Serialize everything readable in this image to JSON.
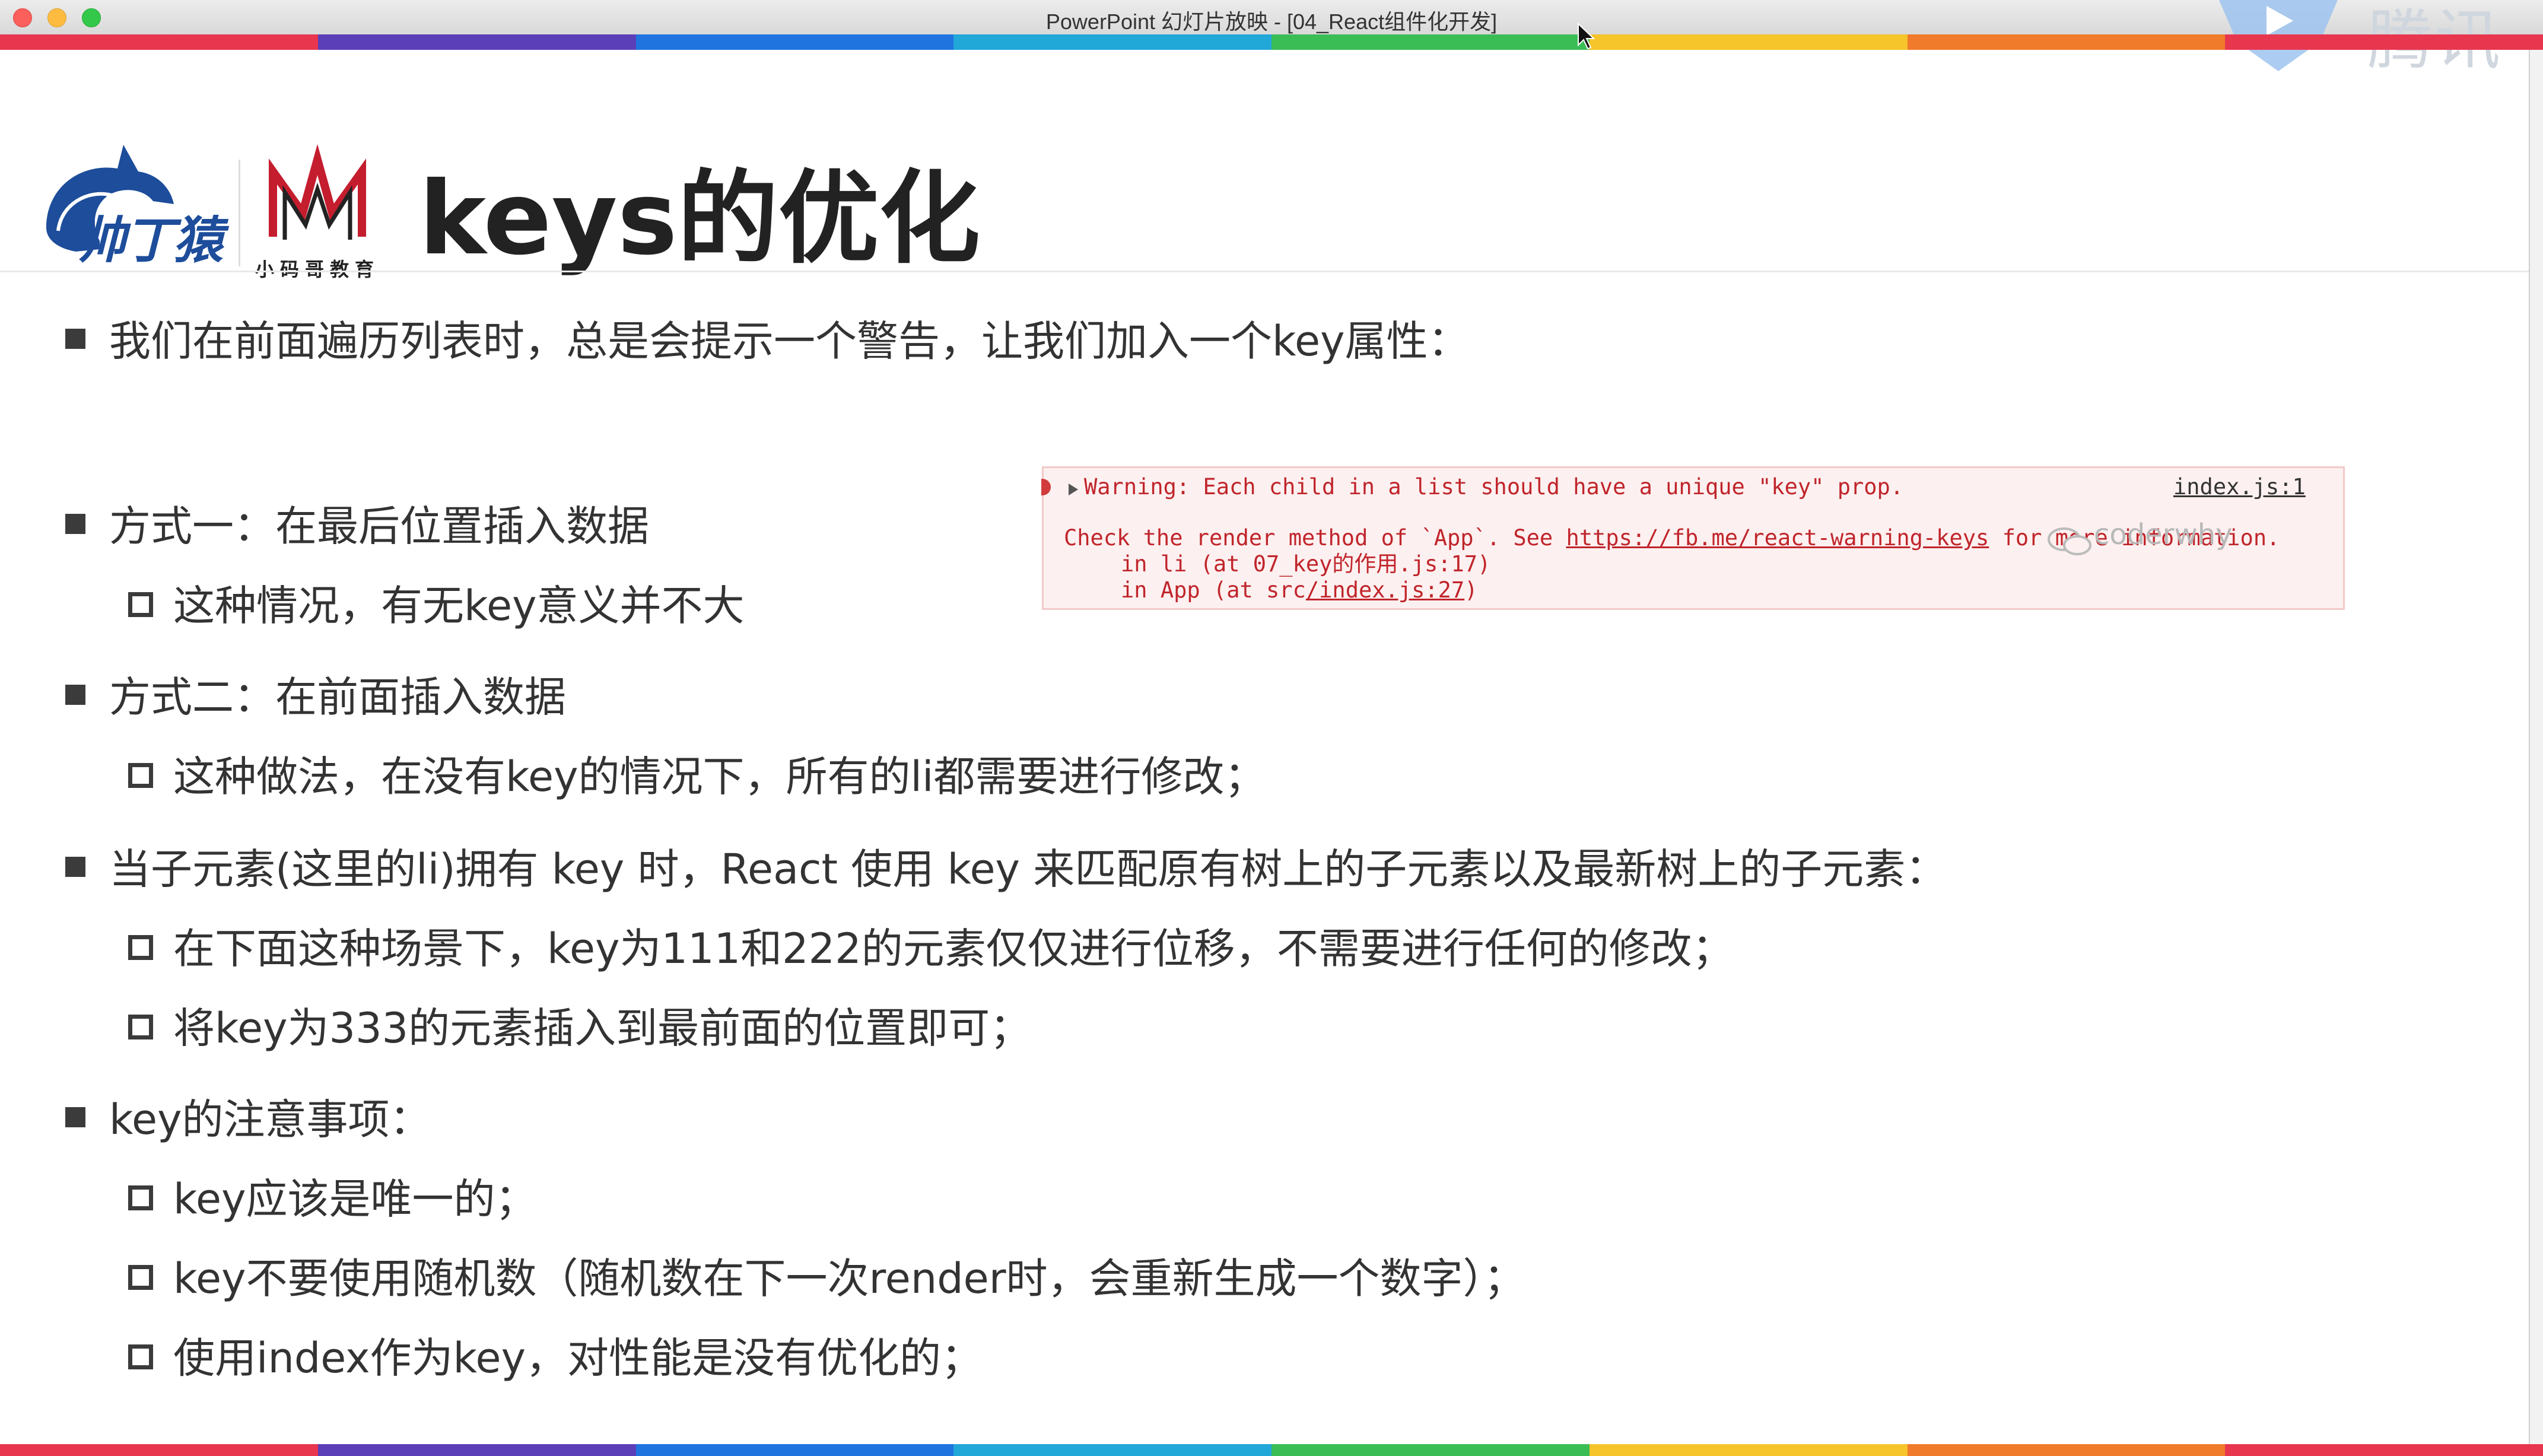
{
  "window": {
    "title": "PowerPoint 幻灯片放映 - [04_React组件化开发]"
  },
  "watermark": {
    "text": "腾讯"
  },
  "stripe_colors": [
    "#e8364f",
    "#5b3fb8",
    "#1f74e0",
    "#22a7d9",
    "#3bbd56",
    "#f6c42b",
    "#f07b2a",
    "#e8364f"
  ],
  "logos": {
    "logo1_text": "帅丁猿",
    "logo2_text": "小码哥教育"
  },
  "slide": {
    "title": "keys的优化",
    "bullets": [
      {
        "level": 1,
        "text": "我们在前面遍历列表时，总是会提示一个警告，让我们加入一个key属性："
      },
      {
        "level": 1,
        "text": "方式一：在最后位置插入数据"
      },
      {
        "level": 2,
        "text": "这种情况，有无key意义并不大"
      },
      {
        "level": 1,
        "text": "方式二：在前面插入数据"
      },
      {
        "level": 2,
        "text": "这种做法，在没有key的情况下，所有的li都需要进行修改；"
      },
      {
        "level": 1,
        "text": "当子元素(这里的li)拥有 key 时，React 使用 key 来匹配原有树上的子元素以及最新树上的子元素："
      },
      {
        "level": 2,
        "text": "在下面这种场景下，key为111和222的元素仅仅进行位移，不需要进行任何的修改；"
      },
      {
        "level": 2,
        "text": "将key为333的元素插入到最前面的位置即可；"
      },
      {
        "level": 1,
        "text": "key的注意事项："
      },
      {
        "level": 2,
        "text": "key应该是唯一的；"
      },
      {
        "level": 2,
        "text": "key不要使用随机数（随机数在下一次render时，会重新生成一个数字）；"
      },
      {
        "level": 2,
        "text": "使用index作为key，对性能是没有优化的；"
      }
    ]
  },
  "console": {
    "warning": "Warning: Each child in a list should have a unique \"key\" prop.",
    "source_link": "index.js:1",
    "check_prefix": "Check the render method of `App`. See ",
    "check_link": "https://fb.me/react-warning-keys",
    "check_suffix": " for more information.",
    "trace_line1": "in li (at 07_key的作用.js:17)",
    "trace_line2_prefix": "in App (at src",
    "trace_line2_link": "/index.js:27",
    "trace_line2_suffix": ")",
    "watermark": "coderwhy"
  }
}
